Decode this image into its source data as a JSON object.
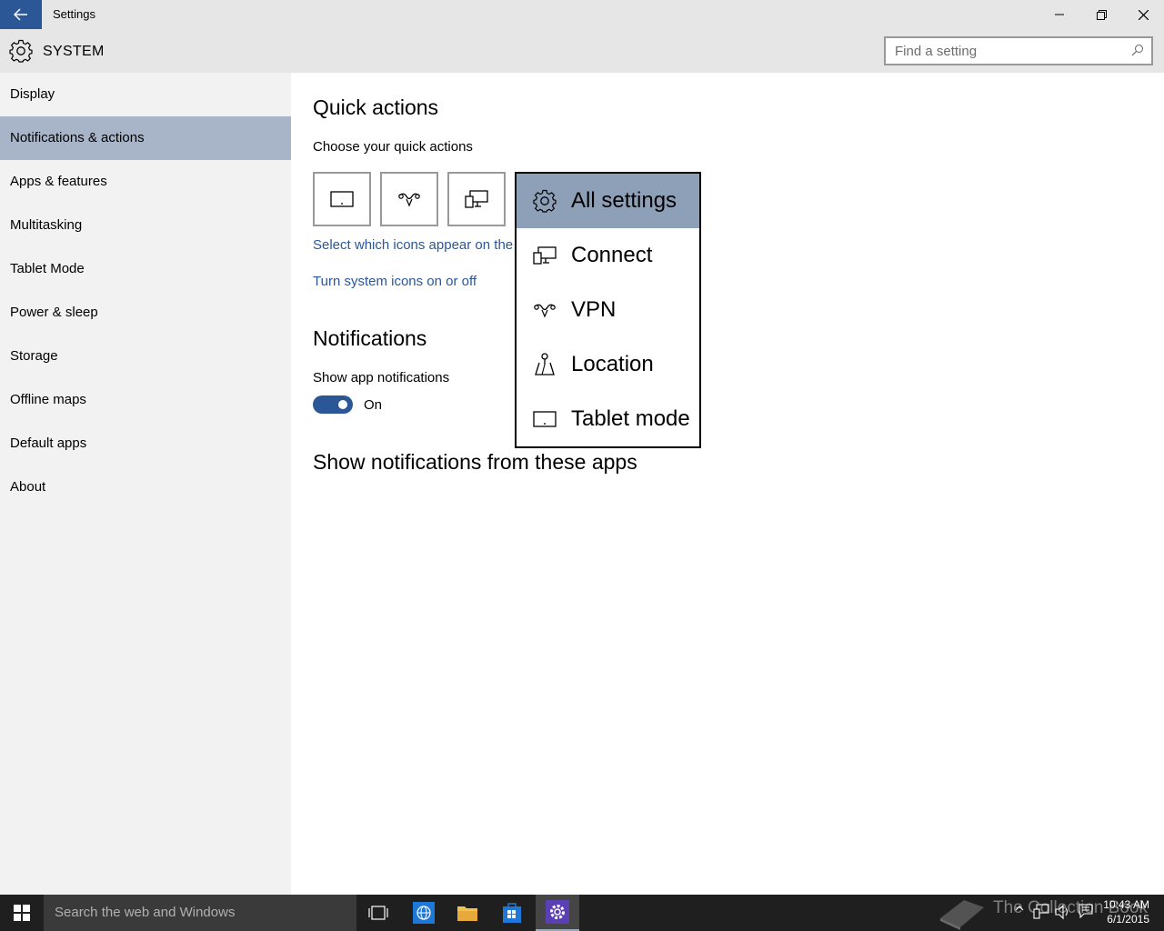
{
  "window": {
    "title": "Settings",
    "back_icon": "arrow-left-icon",
    "minimize_icon": "minimize-icon",
    "restore_icon": "restore-icon",
    "close_icon": "close-icon"
  },
  "header": {
    "icon": "gear-icon",
    "title": "SYSTEM",
    "search_placeholder": "Find a setting",
    "search_icon": "search-icon"
  },
  "sidebar": {
    "items": [
      {
        "label": "Display"
      },
      {
        "label": "Notifications & actions",
        "selected": true
      },
      {
        "label": "Apps & features"
      },
      {
        "label": "Multitasking"
      },
      {
        "label": "Tablet Mode"
      },
      {
        "label": "Power & sleep"
      },
      {
        "label": "Storage"
      },
      {
        "label": "Offline maps"
      },
      {
        "label": "Default apps"
      },
      {
        "label": "About"
      }
    ]
  },
  "main": {
    "quick_actions_heading": "Quick actions",
    "choose_label": "Choose your quick actions",
    "tiles": [
      {
        "icon": "tablet-mode-icon"
      },
      {
        "icon": "vpn-icon"
      },
      {
        "icon": "connect-icon"
      }
    ],
    "select_icons_link": "Select which icons appear on the t",
    "system_icons_link": "Turn system icons on or off",
    "notifications_heading": "Notifications",
    "show_app_notifications_label": "Show app notifications",
    "toggle_state": "On",
    "show_from_apps_heading": "Show notifications from these apps"
  },
  "flyout": {
    "items": [
      {
        "label": "All settings",
        "icon": "gear-icon",
        "selected": true
      },
      {
        "label": "Connect",
        "icon": "connect-icon"
      },
      {
        "label": "VPN",
        "icon": "vpn-icon"
      },
      {
        "label": "Location",
        "icon": "location-icon"
      },
      {
        "label": "Tablet mode",
        "icon": "tablet-mode-icon"
      }
    ]
  },
  "taskbar": {
    "search_placeholder": "Search the web and Windows",
    "watermark": "The Collection Book",
    "time": "10:43 AM",
    "date": "6/1/2015",
    "accent": "#2b5797",
    "selected_nav_color": "#a8b5c9",
    "selected_flyout_color": "#8e9fb8"
  }
}
